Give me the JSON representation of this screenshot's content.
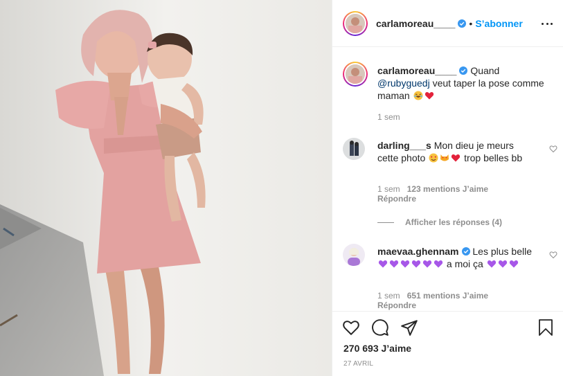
{
  "post": {
    "author": "carlamoreau____",
    "follow_label": "S’abonner",
    "separator": "•",
    "caption_mention": "@rubyguedj",
    "caption_pre": "Quand",
    "caption_post": "veut taper la pose comme maman",
    "caption_time": "1 sem"
  },
  "comments": [
    {
      "user": "darling___s",
      "text": "Mon dieu je meurs cette photo",
      "text_after": "trop belles bb",
      "time": "1 sem",
      "likes": "123 mentions J’aime",
      "reply": "Répondre",
      "view_replies": "Afficher les réponses (4)"
    },
    {
      "user": "maevaa.ghennam",
      "text": "Les plus belle",
      "text_mid": "a moi ça",
      "time": "1 sem",
      "likes": "651 mentions J’aime",
      "reply": "Répondre"
    }
  ],
  "actions": {
    "likes_count": "270 693 J’aime",
    "date": "27 AVRIL"
  },
  "icons": [
    "heart-icon",
    "comment-icon",
    "share-icon",
    "bookmark-icon",
    "more-options-icon",
    "verified-icon"
  ],
  "colors": {
    "link": "#0095f6",
    "mention": "#00376b",
    "muted": "#8e8e8e",
    "verified": "#3897f0"
  }
}
